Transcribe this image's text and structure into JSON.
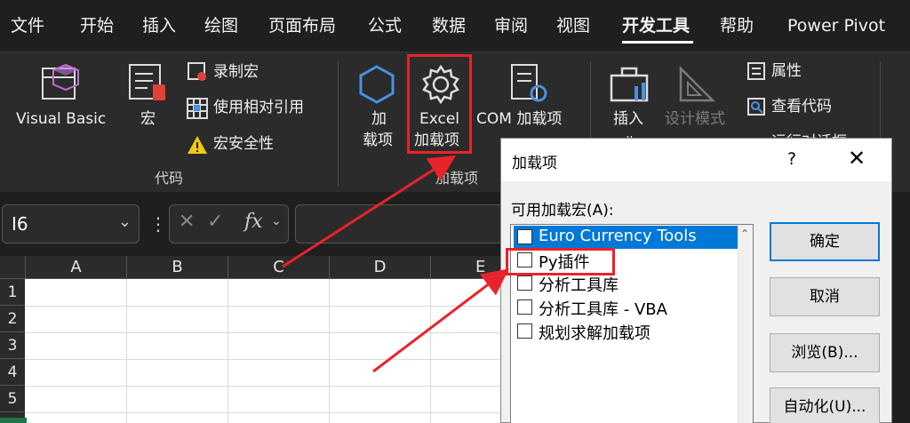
{
  "menu": {
    "tabs": [
      "文件",
      "开始",
      "插入",
      "绘图",
      "页面布局",
      "公式",
      "数据",
      "审阅",
      "视图",
      "开发工具",
      "帮助",
      "Power Pivot"
    ],
    "active_tab": "开发工具"
  },
  "ribbon": {
    "code_group": {
      "visual_basic": "Visual Basic",
      "macros": "宏",
      "record_macro": "录制宏",
      "relative_ref": "使用相对引用",
      "macro_security": "宏安全性",
      "group_label": "代码"
    },
    "addins_group": {
      "addins_line1": "加",
      "addins_line2": "载项",
      "excel_addins_line1": "Excel",
      "excel_addins_line2": "加载项",
      "com_addins": "COM 加载项",
      "group_label": "加载项"
    },
    "controls_group": {
      "insert_line1": "插入",
      "insert_line2": "∨",
      "design_mode": "设计模式",
      "properties": "属性",
      "view_code": "查看代码",
      "run_dialog_partial": "运行对话框"
    }
  },
  "formula_bar": {
    "name_box": "I6",
    "fx": "fx"
  },
  "grid": {
    "columns": [
      "A",
      "B",
      "C",
      "D",
      "E"
    ],
    "rows": [
      "1",
      "2",
      "3",
      "4",
      "5"
    ]
  },
  "dialog": {
    "title": "加载项",
    "help": "?",
    "close": "✕",
    "list_label": "可用加载宏(A):",
    "items": [
      {
        "label": "Euro Currency Tools",
        "checked": false,
        "selected": true
      },
      {
        "label": "Py插件",
        "checked": false,
        "selected": false
      },
      {
        "label": "分析工具库",
        "checked": false,
        "selected": false
      },
      {
        "label": "分析工具库 - VBA",
        "checked": false,
        "selected": false
      },
      {
        "label": "规划求解加载项",
        "checked": false,
        "selected": false
      }
    ],
    "buttons": {
      "ok": "确定",
      "cancel": "取消",
      "browse": "浏览(B)...",
      "automation": "自动化(U)..."
    }
  },
  "colors": {
    "highlight": "#e8232b",
    "selection": "#0078d7",
    "excel_green": "#217346"
  }
}
